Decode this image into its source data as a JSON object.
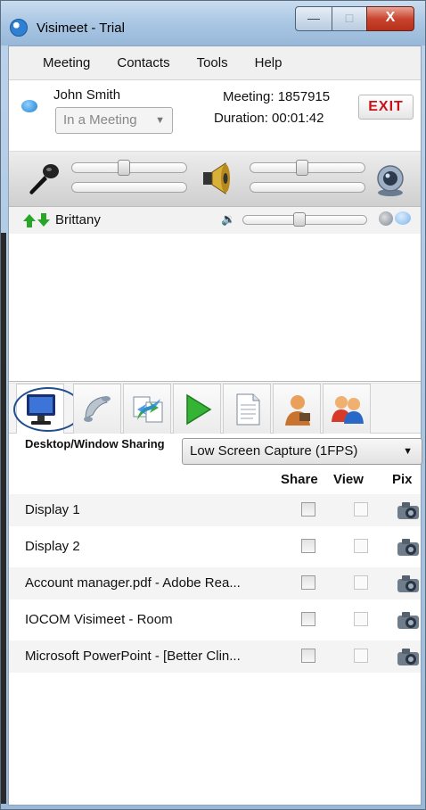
{
  "window": {
    "title": "Visimeet - Trial",
    "close_label": "X",
    "minimize_label": "—",
    "maximize_label": "□"
  },
  "menu": [
    "Meeting",
    "Contacts",
    "Tools",
    "Help"
  ],
  "user": {
    "name": "John Smith",
    "status": "In a Meeting",
    "meeting_label": "Meeting:",
    "meeting_id": "1857915",
    "duration_label": "Duration:",
    "duration": "00:01:42",
    "exit_label": "EXIT"
  },
  "controls": {
    "mic_level": 0.45,
    "speaker_level": 0.45
  },
  "participant": {
    "name": "Brittany",
    "volume_level": 0.45,
    "volume_glyph": "🔉"
  },
  "tabs": [
    "desktop-sharing",
    "telephone",
    "transfer",
    "play",
    "document",
    "presenter",
    "people"
  ],
  "sharing": {
    "title": "Desktop/Window Sharing",
    "capture_mode": "Low Screen Capture (1FPS)",
    "columns": {
      "share": "Share",
      "view": "View",
      "pix": "Pix"
    },
    "items": [
      "Display 1",
      "Display 2",
      "Account manager.pdf - Adobe Rea...",
      "IOCOM Visimeet - Room",
      "Microsoft PowerPoint - [Better Clin..."
    ]
  },
  "colors": {
    "exit": "#c8121a",
    "titlebar": "#a9c6e3",
    "close": "#c8452f"
  }
}
